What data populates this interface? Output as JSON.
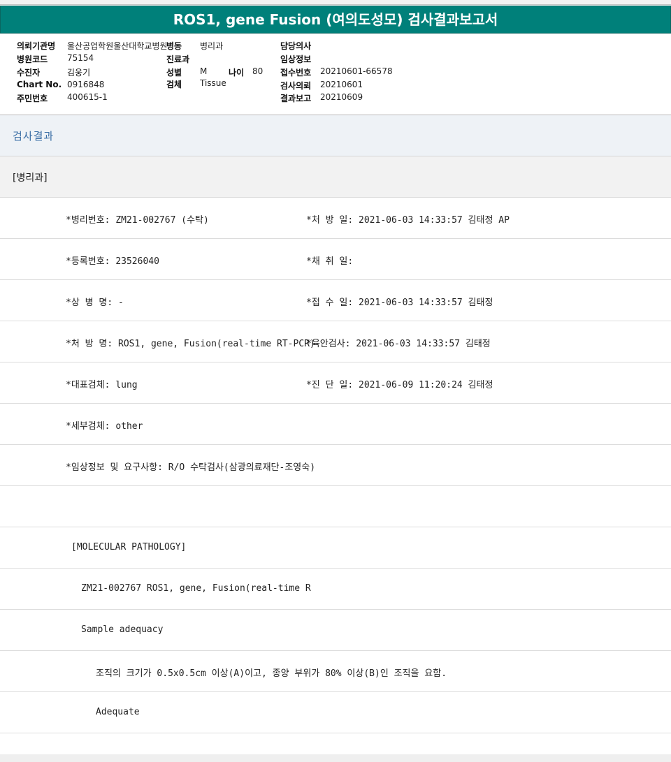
{
  "report": {
    "title": "ROS1, gene Fusion (여의도성모) 검사결과보고서"
  },
  "info": {
    "institution_label": "의뢰기관명",
    "institution_value": "울산공업학원울산대학교병원",
    "ward_label": "병동",
    "ward_value": "병리과",
    "doctor_label": "담당의사",
    "doctor_value": "",
    "hospital_code_label": "병원코드",
    "hospital_code_value": "75154",
    "dept_label": "진료과",
    "dept_value": "",
    "clinical_label": "임상정보",
    "clinical_value": "",
    "patient_label": "수진자",
    "patient_value": "김웅기",
    "sex_label": "성별",
    "sex_value": "M",
    "age_label": "나이",
    "age_value": "80",
    "receipt_label": "접수번호",
    "receipt_value": "20210601-66578",
    "chart_label": "Chart No.",
    "chart_value": "0916848",
    "specimen_label": "검체",
    "specimen_value": "Tissue",
    "request_label": "검사의뢰",
    "request_value": "20210601",
    "resident_label": "주민번호",
    "resident_value": "400615-1",
    "report_label": "결과보고",
    "report_value": "20210609"
  },
  "section": {
    "title": "검사결과",
    "dept_tag": "[병리과]"
  },
  "results": [
    {
      "left": "*병리번호: ZM21-002767 (수탁)",
      "right": "*처 방 일: 2021-06-03 14:33:57  김태정 AP"
    },
    {
      "left": "*등록번호: 23526040",
      "right": "*채 취 일:"
    },
    {
      "left": "*상 병 명: -",
      "right": "*접 수 일: 2021-06-03 14:33:57  김태정"
    },
    {
      "left": "*처 방 명: ROS1, gene, Fusion(real-time RT-PCR)",
      "right": "*육안검사: 2021-06-03 14:33:57  김태정"
    },
    {
      "left": "*대표검체: lung",
      "right": "*진 단 일: 2021-06-09 11:20:24  김태정"
    },
    {
      "left": "*세부검체: other",
      "right": ""
    },
    {
      "left": "*임상정보 및 요구사항: R/O 수탁검사(삼광의료재단-조영숙)",
      "right": ""
    },
    {
      "left": "",
      "right": ""
    }
  ],
  "report_lines": [
    "[MOLECULAR PATHOLOGY]",
    "ZM21-002767     ROS1, gene, Fusion(real-time R",
    "Sample adequacy",
    "조직의 크기가 0.5x0.5cm 이상(A)이고, 종양 부위가 80% 이상(B)인 조직을 요함.",
    "Adequate"
  ]
}
